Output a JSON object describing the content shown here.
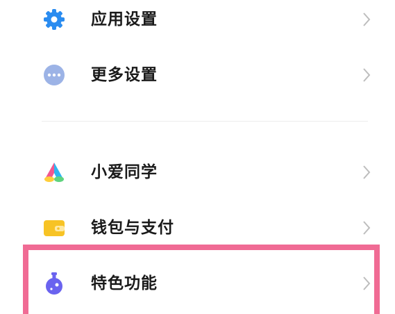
{
  "settings_list": {
    "items": [
      {
        "label": "应用设置",
        "icon": "gear-icon",
        "icon_color": "#2a8cf0"
      },
      {
        "label": "更多设置",
        "icon": "more-dots-icon",
        "icon_color": "#9cb3e6"
      },
      {
        "label": "小爱同学",
        "icon": "xiaoai-icon",
        "icon_color": "#f2578f"
      },
      {
        "label": "钱包与支付",
        "icon": "wallet-icon",
        "icon_color": "#f7c325"
      },
      {
        "label": "特色功能",
        "icon": "flask-icon",
        "icon_color": "#6a63ef"
      }
    ],
    "chevron_icon": "chevron-right-icon",
    "chevron_color": "#bdbdbd"
  },
  "annotation": {
    "highlight_color": "#f06b94",
    "highlighted_item": "特色功能"
  }
}
